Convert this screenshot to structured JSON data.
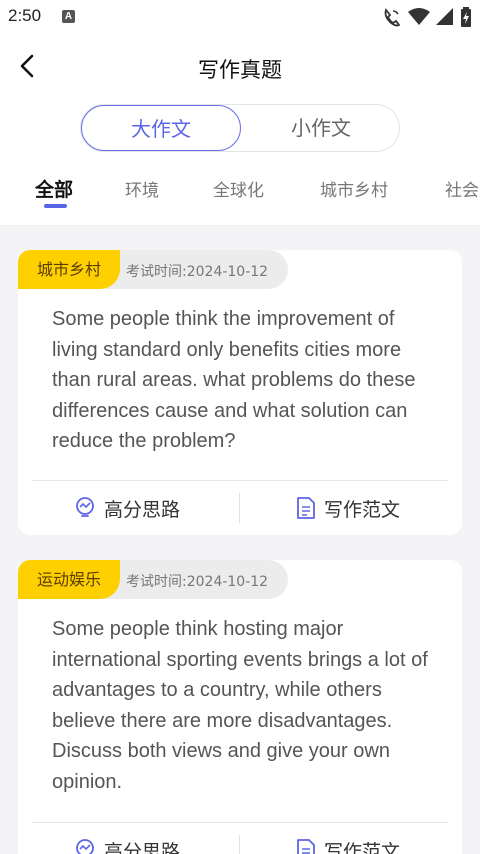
{
  "status_bar": {
    "time": "2:50",
    "notification_letter": "A"
  },
  "header": {
    "title": "写作真题"
  },
  "segments": [
    {
      "label": "大作文",
      "active": true
    },
    {
      "label": "小作文",
      "active": false
    }
  ],
  "category_tabs": [
    {
      "label": "全部",
      "active": true
    },
    {
      "label": "环境",
      "active": false
    },
    {
      "label": "全球化",
      "active": false
    },
    {
      "label": "城市乡村",
      "active": false
    },
    {
      "label": "社会",
      "active": false
    }
  ],
  "cards": [
    {
      "tag": "城市乡村",
      "exam_time": "考试时间:2024-10-12",
      "question": "Some people think the improvement of living standard only benefits cities more than rural areas. what problems do these differences cause and what solution can reduce the problem?",
      "action_ideas": "高分思路",
      "action_sample": "写作范文"
    },
    {
      "tag": "运动娱乐",
      "exam_time": "考试时间:2024-10-12",
      "question": "Some people think hosting major international sporting events brings a lot of advantages to a country, while others believe there are more disadvantages. Discuss both views and give your own opinion.",
      "action_ideas": "高分思路",
      "action_sample": "写作范文"
    }
  ],
  "colors": {
    "accent": "#5b66e6",
    "tag_bg": "#ffd000",
    "background": "#f4f4f6"
  }
}
